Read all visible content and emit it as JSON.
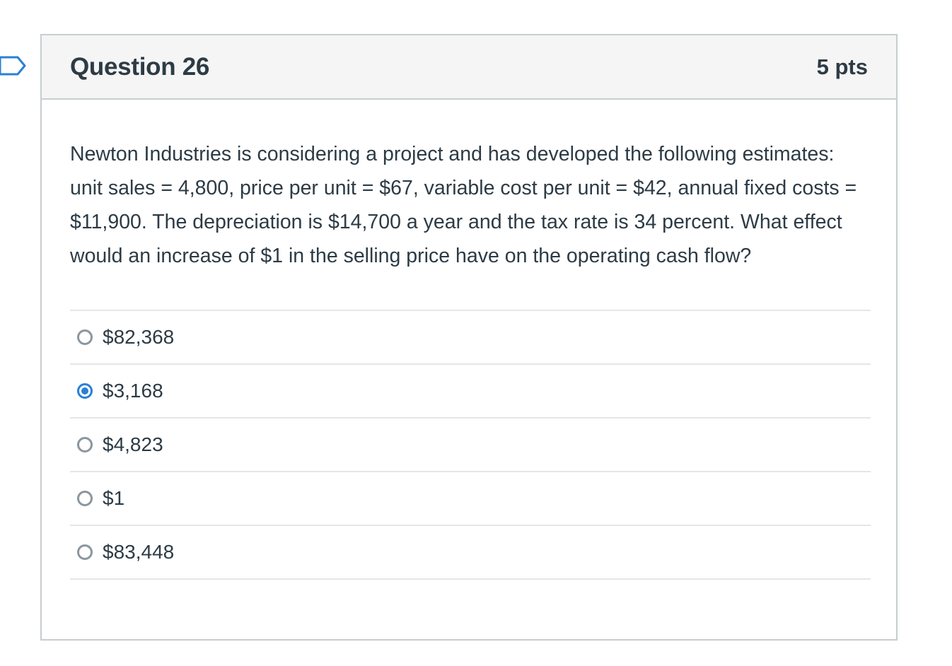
{
  "question": {
    "title": "Question 26",
    "points": "5 pts",
    "text": "Newton Industries is considering a project and has developed the following estimates: unit sales = 4,800, price per unit = $67, variable cost per unit = $42, annual fixed costs = $11,900. The depreciation is $14,700 a year and the tax rate is 34 percent. What effect would an increase of $1 in the selling price have on the operating cash flow?"
  },
  "answers": [
    {
      "label": "$82,368",
      "selected": false
    },
    {
      "label": "$3,168",
      "selected": true
    },
    {
      "label": "$4,823",
      "selected": false
    },
    {
      "label": "$1",
      "selected": false
    },
    {
      "label": "$83,448",
      "selected": false
    }
  ],
  "colors": {
    "accent": "#2a7fd4",
    "text": "#2d3b45",
    "border": "#c7cdd1",
    "header_bg": "#f5f5f5"
  }
}
